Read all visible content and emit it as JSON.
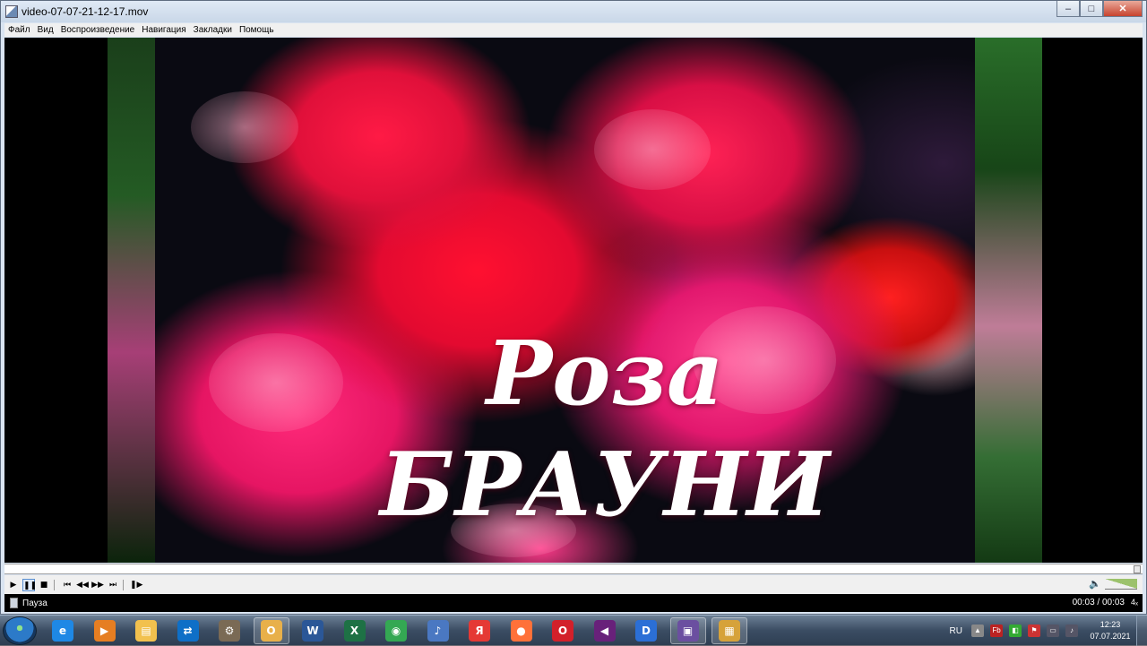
{
  "window": {
    "title": "video-07-07-21-12-17.mov",
    "controls": {
      "minimize": "–",
      "maximize": "□",
      "close": "✕"
    }
  },
  "menu": {
    "items": [
      {
        "label": "Файл"
      },
      {
        "label": "Вид"
      },
      {
        "label": "Воспроизведение"
      },
      {
        "label": "Навигация"
      },
      {
        "label": "Закладки"
      },
      {
        "label": "Помощь"
      }
    ]
  },
  "video": {
    "overlay_line1": "Роза",
    "overlay_line2": "БРАУНИ"
  },
  "playback": {
    "buttons": {
      "play": "▶",
      "pause": "❚❚",
      "stop": "■",
      "prev": "⏮",
      "rewind": "◀◀",
      "forward": "▶▶",
      "next": "⏭",
      "frame_step": "❚▶"
    },
    "position_fraction": 1.0
  },
  "status": {
    "state": "Пауза",
    "time": "00:03 / 00:03",
    "extra": "4ₓ"
  },
  "taskbar": {
    "apps": [
      {
        "name": "internet-explorer",
        "glyph": "e",
        "color": "#1e88e5"
      },
      {
        "name": "media-player",
        "glyph": "▶",
        "color": "#e67e22"
      },
      {
        "name": "file-explorer",
        "glyph": "▤",
        "color": "#f2c14e"
      },
      {
        "name": "teamviewer",
        "glyph": "⇄",
        "color": "#0e6fc7"
      },
      {
        "name": "installer",
        "glyph": "⚙",
        "color": "#7a6a55"
      },
      {
        "name": "outlook",
        "glyph": "O",
        "color": "#e8b04a"
      },
      {
        "name": "word",
        "glyph": "W",
        "color": "#2b5797"
      },
      {
        "name": "excel",
        "glyph": "X",
        "color": "#1e7145"
      },
      {
        "name": "chrome",
        "glyph": "◉",
        "color": "#34a853"
      },
      {
        "name": "audio-app",
        "glyph": "♪",
        "color": "#4a78c2"
      },
      {
        "name": "yandex-browser",
        "glyph": "Я",
        "color": "#e53935"
      },
      {
        "name": "firefox",
        "glyph": "●",
        "color": "#ff7139"
      },
      {
        "name": "opera",
        "glyph": "O",
        "color": "#d3202a"
      },
      {
        "name": "visual-studio",
        "glyph": "◀",
        "color": "#68217a"
      },
      {
        "name": "d-app",
        "glyph": "D",
        "color": "#2b6fd6"
      },
      {
        "name": "video-editor",
        "glyph": "▣",
        "color": "#6b4fa0"
      },
      {
        "name": "video-player",
        "glyph": "▦",
        "color": "#d6a23a"
      }
    ],
    "tray": {
      "language": "RU",
      "time": "12:23",
      "date": "07.07.2021"
    }
  }
}
